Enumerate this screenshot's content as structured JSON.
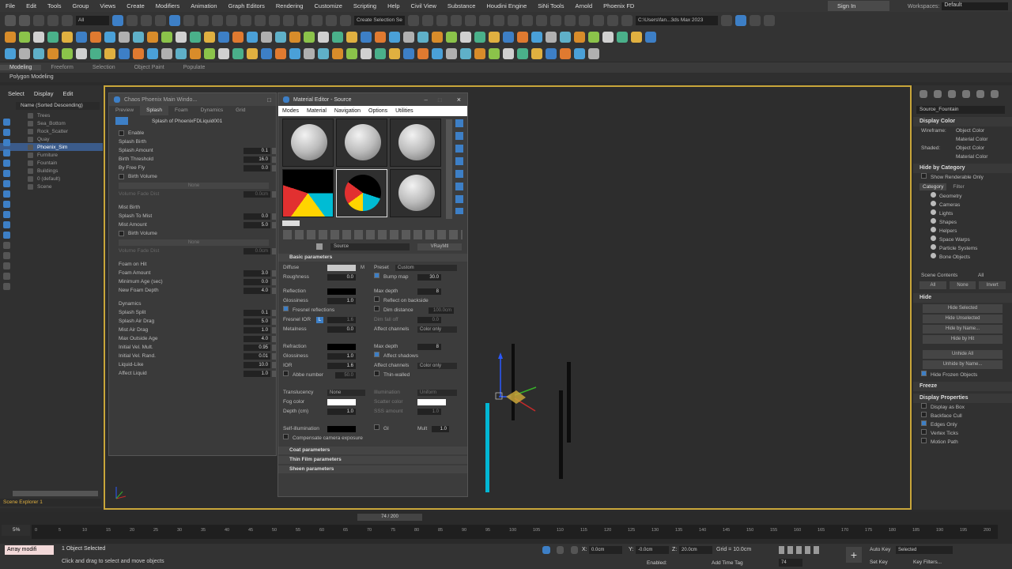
{
  "menu": [
    "File",
    "Edit",
    "Tools",
    "Group",
    "Views",
    "Create",
    "Modifiers",
    "Animation",
    "Graph Editors",
    "Rendering",
    "Customize",
    "Scripting",
    "Help",
    "Civil View",
    "Substance",
    "Houdini Engine",
    "SiNi Tools",
    "Arnold",
    "Phoenix FD"
  ],
  "signin": "Sign In",
  "workspace_label": "Workspaces:",
  "workspace_value": "Default",
  "toolbar": {
    "filter": "All",
    "selection_set": "Create Selection Se",
    "path": "C:\\Users\\fan...3ds Max 2023"
  },
  "ribbon_tabs": [
    "Modeling",
    "Freeform",
    "Selection",
    "Object Paint",
    "Populate"
  ],
  "ribbon_sub": "Polygon Modeling",
  "scene_explorer": {
    "menu": [
      "Select",
      "Display",
      "Edit"
    ],
    "sort": "Name (Sorted Descending)",
    "items": [
      "Trees",
      "Sea_Bottom",
      "Rock_Scatter",
      "Quay",
      "Phoenix_Sim",
      "Furniture",
      "Fountain",
      "Buildings",
      "0 (default)",
      "Scene"
    ],
    "footer": "Scene Explorer 1"
  },
  "phoenix": {
    "title": "Chaos Phoenix Main Windo...",
    "tabs": [
      "Preview",
      "Splash",
      "Foam",
      "Dynamics",
      "Grid"
    ],
    "heading": "Splash of PhoenixFDLiquid001",
    "rows": [
      {
        "type": "check",
        "label": "Enable"
      },
      {
        "type": "head",
        "label": "Splash Birth"
      },
      {
        "type": "num",
        "label": "Splash Amount",
        "value": "0.1"
      },
      {
        "type": "num",
        "label": "Birth Threshold",
        "value": "16.0"
      },
      {
        "type": "num",
        "label": "By Free Fly",
        "value": "0.0"
      },
      {
        "type": "check",
        "label": "Birth Volume"
      },
      {
        "type": "btn",
        "label": "None"
      },
      {
        "type": "num",
        "label": "Volume Fade Dist",
        "value": "0.0cm",
        "dim": true
      },
      {
        "type": "gap",
        "label": ""
      },
      {
        "type": "head",
        "label": "Mist Birth"
      },
      {
        "type": "num",
        "label": "Splash To Mist",
        "value": "0.0"
      },
      {
        "type": "num",
        "label": "Mist Amount",
        "value": "5.0"
      },
      {
        "type": "check",
        "label": "Birth Volume"
      },
      {
        "type": "btn",
        "label": "None"
      },
      {
        "type": "num",
        "label": "Volume Fade Dist",
        "value": "0.0cm",
        "dim": true
      },
      {
        "type": "gap",
        "label": ""
      },
      {
        "type": "head",
        "label": "Foam on Hit"
      },
      {
        "type": "num",
        "label": "Foam Amount",
        "value": "3.0"
      },
      {
        "type": "num",
        "label": "Minimum Age (sec)",
        "value": "0.0"
      },
      {
        "type": "num",
        "label": "New Foam Depth",
        "value": "4.0"
      },
      {
        "type": "gap",
        "label": ""
      },
      {
        "type": "head",
        "label": "Dynamics"
      },
      {
        "type": "num",
        "label": "Splash Split",
        "value": "0.1"
      },
      {
        "type": "num",
        "label": "Splash Air Drag",
        "value": "5.0"
      },
      {
        "type": "num",
        "label": "Mist Air Drag",
        "value": "1.0"
      },
      {
        "type": "num",
        "label": "Max Outside Age",
        "value": "4.0"
      },
      {
        "type": "num",
        "label": "Initial Vel. Mult.",
        "value": "0.95"
      },
      {
        "type": "num",
        "label": "Initial Vel. Rand.",
        "value": "0.01"
      },
      {
        "type": "num",
        "label": "Liquid-Like",
        "value": "10.0"
      },
      {
        "type": "num",
        "label": "Affect Liquid",
        "value": "1.0"
      }
    ]
  },
  "material_editor": {
    "title": "Material Editor - Source",
    "menu": [
      "Modes",
      "Material",
      "Navigation",
      "Options",
      "Utilities"
    ],
    "material_name": "Source",
    "material_type": "VRayMtl",
    "sections": {
      "basic": "Basic parameters",
      "coat": "Coat parameters",
      "thin": "Thin Film parameters",
      "sheen": "Sheen parameters"
    },
    "diffuse": "Diffuse",
    "diffuse_m": "M",
    "preset": "Preset",
    "preset_value": "Custom",
    "roughness": "Roughness",
    "roughness_value": "0.0",
    "bump": "Bump map",
    "bump_value": "30.0",
    "reflection": "Reflection",
    "max_depth": "Max depth",
    "max_depth_value": "8",
    "glossiness": "Glossiness",
    "gloss_value": "1.0",
    "reflect_back": "Reflect on backside",
    "fresnel": "Fresnel reflections",
    "dim_distance": "Dim distance",
    "dim_value": "100.0cm",
    "fresnel_ior": "Fresnel IOR",
    "fresnel_l": "L",
    "fresnel_ior_value": "1.6",
    "dim_falloff": "Dim fall off",
    "dim_falloff_value": "0.0",
    "metalness": "Metalness",
    "metal_value": "0.0",
    "affect_channels": "Affect channels",
    "color_only": "Color only",
    "refraction": "Refraction",
    "refr_depth": "8",
    "refr_gloss": "1.0",
    "affect_shadows": "Affect shadows",
    "ior": "IOR",
    "ior_value": "1.6",
    "abbe": "Abbe number",
    "abbe_value": "50.0",
    "thin_walled": "Thin-walled",
    "translucency": "Translucency",
    "transl_value": "None",
    "illumination": "Illumination",
    "illum_value": "Uniform",
    "fog_color": "Fog color",
    "scatter_color": "Scatter color",
    "depth": "Depth (cm)",
    "depth_value": "1.0",
    "sss_amount": "SSS amount",
    "sss_value": "1.0",
    "self_illum": "Self-illumination",
    "gi": "GI",
    "mult": "Mult",
    "mult_value": "1.0",
    "compensate": "Compensate camera exposure"
  },
  "command_panel": {
    "object_name": "Source_Fountain",
    "display_color": "Display Color",
    "wireframe": "Wireframe:",
    "shaded": "Shaded:",
    "object_color": "Object Color",
    "material_color": "Material Color",
    "hide_by_category": "Hide by Category",
    "show_renderable": "Show Renderable Only",
    "category_tab": "Category",
    "filter_tab": "Filter",
    "categories": [
      "Geometry",
      "Cameras",
      "Lights",
      "Shapes",
      "Helpers",
      "Space Warps",
      "Particle Systems",
      "Bone Objects"
    ],
    "scene_contents": "Scene Contents",
    "all": "All",
    "buttons_row": [
      "All",
      "None",
      "Invert"
    ],
    "hide": "Hide",
    "hide_buttons": [
      "Hide Selected",
      "Hide Unselected",
      "Hide by Name...",
      "Hide by Hit",
      "Unhide All",
      "Unhide by Name..."
    ],
    "hide_frozen": "Hide Frozen Objects",
    "freeze": "Freeze",
    "display_properties": "Display Properties",
    "display_props": [
      "Display as Box",
      "Backface Cull",
      "Edges Only",
      "Vertex Ticks",
      "Motion Path"
    ]
  },
  "timeline": {
    "frame": "74 / 200",
    "percent": "5%",
    "ticks": [
      "0",
      "5",
      "10",
      "15",
      "20",
      "25",
      "30",
      "35",
      "40",
      "45",
      "50",
      "55",
      "60",
      "65",
      "70",
      "75",
      "80",
      "85",
      "90",
      "95",
      "100",
      "105",
      "110",
      "115",
      "120",
      "125",
      "130",
      "135",
      "140",
      "145",
      "150",
      "155",
      "160",
      "165",
      "170",
      "175",
      "180",
      "185",
      "190",
      "195",
      "200"
    ]
  },
  "status": {
    "maxscript": "Array modifi",
    "selected": "1 Object Selected",
    "hint": "Click and drag to select and move objects",
    "x_label": "X:",
    "x": "0.0cm",
    "y_label": "Y:",
    "y": "-0.0cm",
    "z_label": "Z:",
    "z": "20.0cm",
    "grid": "Grid = 10.0cm",
    "enabled": "Enabled:",
    "add_time_tag": "Add Time Tag",
    "auto_key": "Auto Key",
    "set_key": "Set Key",
    "key_filters": "Key Filters...",
    "selected_dd": "Selected",
    "frame_field": "74"
  },
  "colors": {
    "accent": "#3d7fc6",
    "viewport_border": "#c9a63a",
    "cyan_object": "#00b7d4"
  }
}
